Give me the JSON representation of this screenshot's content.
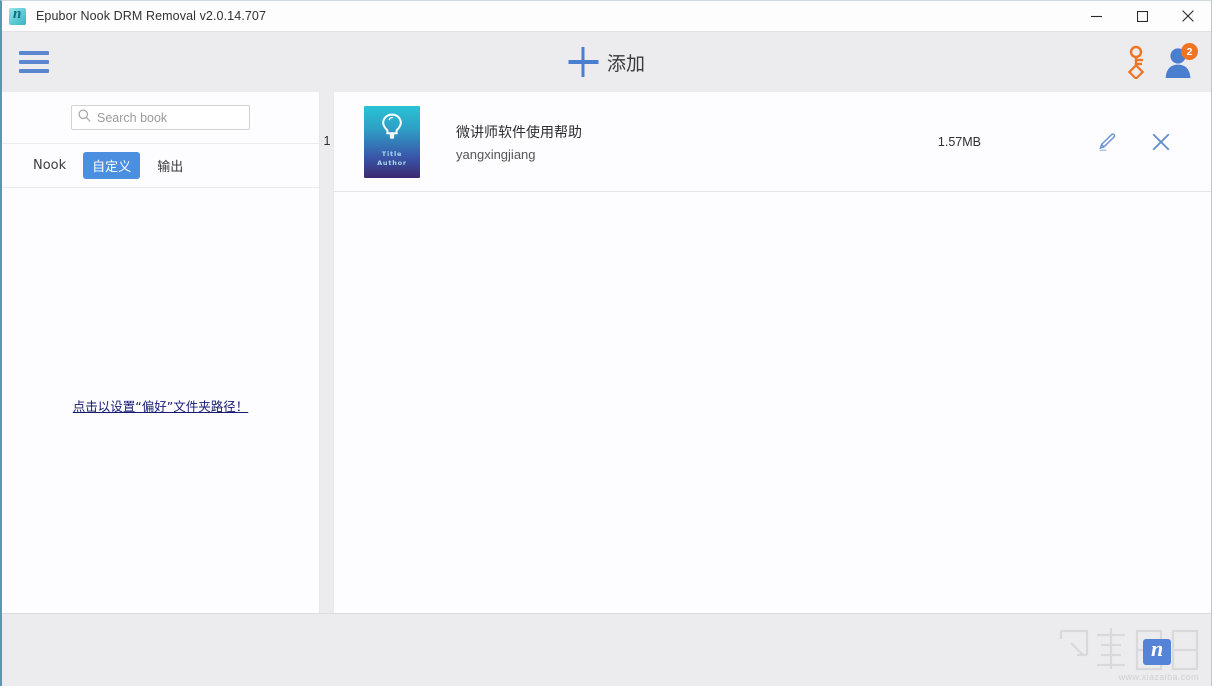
{
  "window": {
    "title": "Epubor Nook DRM Removal v2.0.14.707",
    "app_icon": "nook-app-icon",
    "controls": {
      "minimize": "minimize-icon",
      "maximize": "maximize-icon",
      "close": "close-icon"
    }
  },
  "toolbar": {
    "menu_icon": "hamburger-menu-icon",
    "add_label": "添加",
    "add_icon": "plus-icon",
    "key_icon": "key-icon",
    "account_icon": "account-avatar-icon",
    "account_badge": "2",
    "accent_blue": "#4a7fd0",
    "accent_orange": "#ec7424"
  },
  "sidebar": {
    "search": {
      "icon": "search-icon",
      "value": "",
      "placeholder": "Search book"
    },
    "tabs": [
      {
        "label": "Nook",
        "active": false
      },
      {
        "label": "自定义",
        "active": true
      },
      {
        "label": "输出",
        "active": false
      }
    ],
    "pref_link": "点击以设置“偏好”文件夹路径！"
  },
  "main": {
    "row_number": "1",
    "books": [
      {
        "cover": {
          "icon": "lightbulb-icon",
          "line1": "Title",
          "line2": "Author",
          "gradient_top": "#29c3d4",
          "gradient_bottom": "#3b2a70"
        },
        "title": "微讲师软件使用帮助",
        "author": "yangxingjiang",
        "size": "1.57MB",
        "edit_icon": "pencil-edit-icon",
        "remove_icon": "close-x-icon"
      }
    ]
  },
  "footer": {
    "watermark_text": "www.xiazaiba.com",
    "watermark_logo": "xiazaiba-logo"
  }
}
